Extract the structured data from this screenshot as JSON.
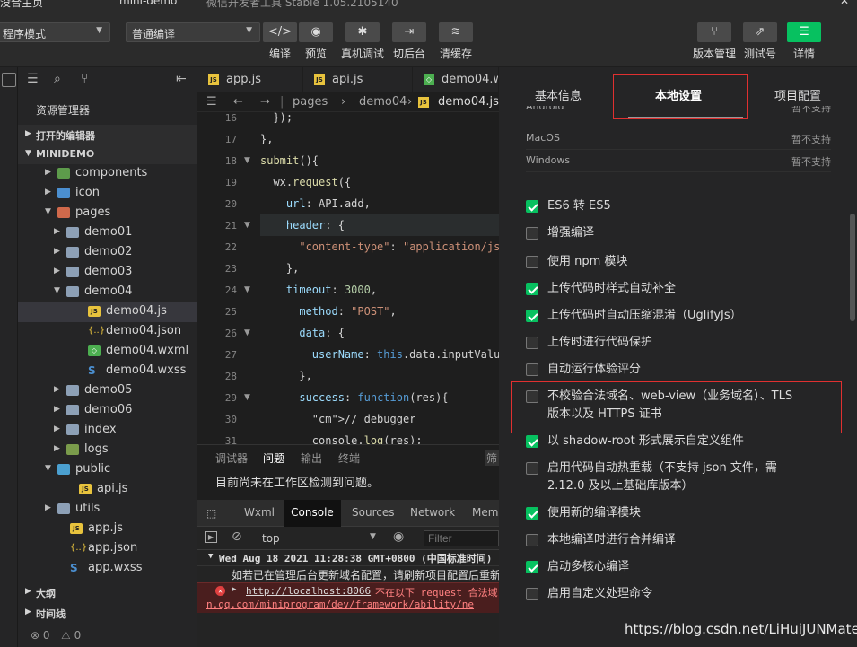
{
  "titlebar": {
    "left": "没合主页",
    "center": "mini-demo",
    "right": "微信开发者工具 Stable 1.05.2105140"
  },
  "toolbar": {
    "mode_select": "程序模式",
    "compile_select": "普通编译",
    "buttons": [
      {
        "icon": "code-icon",
        "glyph": "</>",
        "label": "编译"
      },
      {
        "icon": "eye-icon",
        "glyph": "◉",
        "label": "预览"
      },
      {
        "icon": "bug-icon",
        "glyph": "✱",
        "label": "真机调试"
      },
      {
        "icon": "switch-icon",
        "glyph": "⇥",
        "label": "切后台"
      },
      {
        "icon": "layers-icon",
        "glyph": "≋",
        "label": "清缓存"
      }
    ],
    "right_buttons": [
      {
        "icon": "branch-icon",
        "glyph": "⑂",
        "label": "版本管理"
      },
      {
        "icon": "external-icon",
        "glyph": "⇗",
        "label": "测试号"
      },
      {
        "icon": "menu-icon",
        "glyph": "☰",
        "label": "详情"
      }
    ]
  },
  "explorer": {
    "title": "资源管理器",
    "open_editors": "打开的编辑器",
    "project": "MINIDEMO",
    "tree": [
      {
        "name": "components",
        "type": "folder-cmp",
        "depth": 1,
        "open": false
      },
      {
        "name": "icon",
        "type": "folder-ico",
        "depth": 1,
        "open": false
      },
      {
        "name": "pages",
        "type": "folder-pgs",
        "depth": 1,
        "open": true
      },
      {
        "name": "demo01",
        "type": "folder",
        "depth": 2,
        "open": false
      },
      {
        "name": "demo02",
        "type": "folder",
        "depth": 2,
        "open": false
      },
      {
        "name": "demo03",
        "type": "folder",
        "depth": 2,
        "open": false
      },
      {
        "name": "demo04",
        "type": "folder",
        "depth": 2,
        "open": true
      },
      {
        "name": "demo04.js",
        "type": "js",
        "depth": 3,
        "selected": true
      },
      {
        "name": "demo04.json",
        "type": "json",
        "depth": 3
      },
      {
        "name": "demo04.wxml",
        "type": "wxml",
        "depth": 3
      },
      {
        "name": "demo04.wxss",
        "type": "wxss",
        "depth": 3
      },
      {
        "name": "demo05",
        "type": "folder",
        "depth": 2,
        "open": false
      },
      {
        "name": "demo06",
        "type": "folder",
        "depth": 2,
        "open": false
      },
      {
        "name": "index",
        "type": "folder",
        "depth": 2,
        "open": false
      },
      {
        "name": "logs",
        "type": "folder-lgs",
        "depth": 2,
        "open": false
      },
      {
        "name": "public",
        "type": "folder-pub",
        "depth": 1,
        "open": true
      },
      {
        "name": "api.js",
        "type": "js",
        "depth": 2
      },
      {
        "name": "utils",
        "type": "folder",
        "depth": 1,
        "open": false
      },
      {
        "name": "app.js",
        "type": "js",
        "depth": 1
      },
      {
        "name": "app.json",
        "type": "json",
        "depth": 1
      },
      {
        "name": "app.wxss",
        "type": "wxss",
        "depth": 1
      }
    ],
    "outline": "大纲",
    "timeline": "时间线",
    "status_errors": "⊗ 0",
    "status_warnings": "⚠ 0"
  },
  "editor": {
    "tabs": [
      {
        "label": "app.js",
        "type": "js"
      },
      {
        "label": "api.js",
        "type": "js"
      },
      {
        "label": "demo04.w",
        "type": "wxml"
      }
    ],
    "breadcrumb": [
      "pages",
      "demo04",
      "demo04.js"
    ],
    "lines": [
      {
        "n": "16",
        "text": "  });"
      },
      {
        "n": "17",
        "text": "},"
      },
      {
        "n": "18",
        "text": "submit(){"
      },
      {
        "n": "19",
        "text": "  wx.request({"
      },
      {
        "n": "20",
        "text": "    url: API.add,"
      },
      {
        "n": "21",
        "text": "    header: {"
      },
      {
        "n": "22",
        "text": "      \"content-type\": \"application/json\""
      },
      {
        "n": "23",
        "text": "    },"
      },
      {
        "n": "24",
        "text": "    timeout: 3000,"
      },
      {
        "n": "25",
        "text": "      method: \"POST\","
      },
      {
        "n": "26",
        "text": "      data: {"
      },
      {
        "n": "27",
        "text": "        userName: this.data.inputValue"
      },
      {
        "n": "28",
        "text": "      },"
      },
      {
        "n": "29",
        "text": "      success: function(res){"
      },
      {
        "n": "30",
        "text": "        // debugger"
      },
      {
        "n": "31",
        "text": "        console.log(res);"
      }
    ]
  },
  "problems": {
    "tabs": [
      "调试器",
      "问题",
      "输出",
      "终端"
    ],
    "right_tab": "筛",
    "message": "目前尚未在工作区检测到问题。"
  },
  "console": {
    "tabs": [
      "Wxml",
      "Console",
      "Sources",
      "Network",
      "Mem"
    ],
    "context": "top",
    "filter_placeholder": "Filter",
    "log_date": "Wed Aug 18 2021 11:28:38 GMT+0800 (中国标准时间)",
    "log_info": "如若已在管理后台更新域名配置，请刷新项目配置后重新",
    "log_error_url": "http://localhost:8066",
    "log_error_text": " 不在以下 request 合法域",
    "log_error_link": "n.qq.com/miniprogram/dev/framework/ability/ne"
  },
  "settings": {
    "tabs": [
      "基本信息",
      "本地设置",
      "项目配置"
    ],
    "os_rows": [
      {
        "name": "Android",
        "status": "暂不支持"
      },
      {
        "name": "MacOS",
        "status": "暂不支持"
      },
      {
        "name": "Windows",
        "status": "暂不支持"
      }
    ],
    "options": [
      {
        "label": "ES6 转 ES5",
        "checked": true
      },
      {
        "label": "增强编译",
        "checked": false
      },
      {
        "label": "使用 npm 模块",
        "checked": false
      },
      {
        "label": "上传代码时样式自动补全",
        "checked": true
      },
      {
        "label": "上传代码时自动压缩混淆（UglifyJs）",
        "checked": true
      },
      {
        "label": "上传时进行代码保护",
        "checked": false
      },
      {
        "label": "自动运行体验评分",
        "checked": false
      },
      {
        "label": "不校验合法域名、web-view（业务域名）、TLS",
        "label2": "版本以及 HTTPS 证书",
        "checked": false
      },
      {
        "label": "以 shadow-root 形式展示自定义组件",
        "checked": true
      },
      {
        "label": "启用代码自动热重载（不支持 json 文件，需",
        "label2": "2.12.0 及以上基础库版本）",
        "checked": false
      },
      {
        "label": "使用新的编译模块",
        "checked": true
      },
      {
        "label": "本地编译时进行合并编译",
        "checked": false
      },
      {
        "label": "启动多核心编译",
        "checked": true
      },
      {
        "label": "启用自定义处理命令",
        "checked": false
      }
    ]
  },
  "watermark": "https://blog.csdn.net/LiHuiJUNMate",
  "colors": {
    "accent": "#07c160",
    "highlight_box": "#e03030",
    "background": "#1e1e1e"
  }
}
